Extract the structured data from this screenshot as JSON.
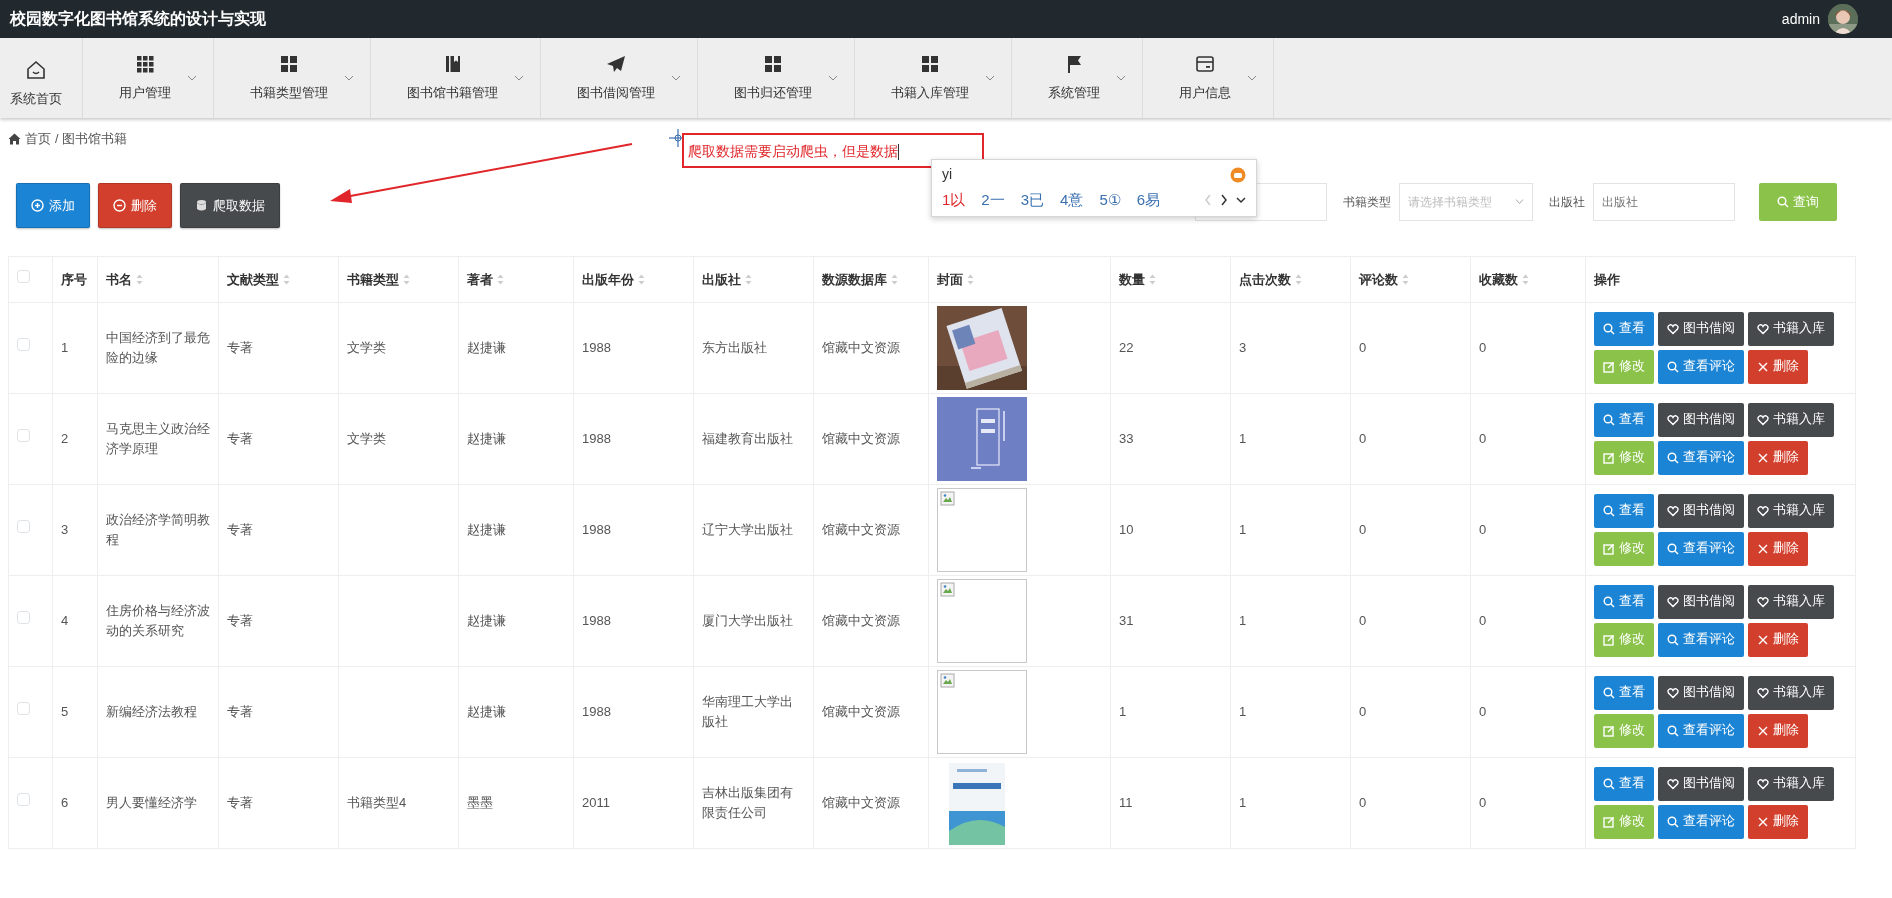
{
  "header": {
    "title": "校园数字化图书馆系统的设计与实现",
    "user": "admin"
  },
  "nav": [
    {
      "label": "系统首页",
      "dropdown": false
    },
    {
      "label": "用户管理",
      "dropdown": true
    },
    {
      "label": "书籍类型管理",
      "dropdown": true
    },
    {
      "label": "图书馆书籍管理",
      "dropdown": true
    },
    {
      "label": "图书借阅管理",
      "dropdown": true
    },
    {
      "label": "图书归还管理",
      "dropdown": true
    },
    {
      "label": "书籍入库管理",
      "dropdown": true
    },
    {
      "label": "系统管理",
      "dropdown": true
    },
    {
      "label": "用户信息",
      "dropdown": true
    }
  ],
  "breadcrumb": {
    "items": [
      "首页",
      "图书馆书籍"
    ],
    "separator": "/"
  },
  "toolbar": [
    {
      "label": "添加",
      "kind": "add"
    },
    {
      "label": "删除",
      "kind": "delete"
    },
    {
      "label": "爬取数据",
      "kind": "crawl"
    }
  ],
  "annotation": {
    "text": "爬取数据需要启动爬虫，但是数据"
  },
  "ime": {
    "input": "yi",
    "candidates": [
      {
        "label": "1以",
        "selected": true
      },
      {
        "label": "2一",
        "selected": false
      },
      {
        "label": "3已",
        "selected": false
      },
      {
        "label": "4意",
        "selected": false
      },
      {
        "label": "5①",
        "selected": false
      },
      {
        "label": "6易",
        "selected": false
      }
    ]
  },
  "search": {
    "fields": [
      {
        "kind": "input"
      },
      {
        "label": "书籍类型",
        "kind": "select",
        "placeholder": "请选择书籍类型"
      },
      {
        "label": "出版社",
        "kind": "input",
        "placeholder": "出版社"
      }
    ],
    "button": "查询"
  },
  "table": {
    "select_all": {
      "checked": false
    },
    "columns": [
      {
        "label": "序号",
        "sortable": false
      },
      {
        "label": "书名",
        "sortable": true
      },
      {
        "label": "文献类型",
        "sortable": true
      },
      {
        "label": "书籍类型",
        "sortable": true
      },
      {
        "label": "著者",
        "sortable": true
      },
      {
        "label": "出版年份",
        "sortable": true
      },
      {
        "label": "出版社",
        "sortable": true
      },
      {
        "label": "数源数据库",
        "sortable": true
      },
      {
        "label": "封面",
        "sortable": true
      },
      {
        "label": "数量",
        "sortable": true
      },
      {
        "label": "点击次数",
        "sortable": true
      },
      {
        "label": "评论数",
        "sortable": true
      },
      {
        "label": "收藏数",
        "sortable": true
      },
      {
        "label": "操作",
        "sortable": false
      }
    ],
    "rows": [
      {
        "checked": false,
        "no": "1",
        "title": "中国经济到了最危险的边缘",
        "doc_type": "专著",
        "book_type": "文学类",
        "author": "赵捷谦",
        "year": "1988",
        "publisher": "东方出版社",
        "source": "馆藏中文资源",
        "count": "22",
        "clicks": "3",
        "comments": "0",
        "favorites": "0",
        "actions": [
          {
            "label": "查看",
            "kind": "view"
          },
          {
            "label": "图书借阅",
            "kind": "borrow"
          },
          {
            "label": "书籍入库",
            "kind": "stock"
          },
          {
            "label": "修改",
            "kind": "edit"
          },
          {
            "label": "查看评论",
            "kind": "review"
          },
          {
            "label": "删除",
            "kind": "delete"
          }
        ]
      },
      {
        "checked": false,
        "no": "2",
        "title": "马克思主义政治经济学原理",
        "doc_type": "专著",
        "book_type": "文学类",
        "author": "赵捷谦",
        "year": "1988",
        "publisher": "福建教育出版社",
        "source": "馆藏中文资源",
        "count": "33",
        "clicks": "1",
        "comments": "0",
        "favorites": "0",
        "actions": [
          {
            "label": "查看",
            "kind": "view"
          },
          {
            "label": "图书借阅",
            "kind": "borrow"
          },
          {
            "label": "书籍入库",
            "kind": "stock"
          },
          {
            "label": "修改",
            "kind": "edit"
          },
          {
            "label": "查看评论",
            "kind": "review"
          },
          {
            "label": "删除",
            "kind": "delete"
          }
        ]
      },
      {
        "checked": false,
        "no": "3",
        "title": "政治经济学简明教程",
        "doc_type": "专著",
        "author": "赵捷谦",
        "year": "1988",
        "publisher": "辽宁大学出版社",
        "source": "馆藏中文资源",
        "cover": {
          "kind": "broken"
        },
        "count": "10",
        "clicks": "1",
        "comments": "0",
        "favorites": "0",
        "actions": [
          {
            "label": "查看",
            "kind": "view"
          },
          {
            "label": "图书借阅",
            "kind": "borrow"
          },
          {
            "label": "书籍入库",
            "kind": "stock"
          },
          {
            "label": "修改",
            "kind": "edit"
          },
          {
            "label": "查看评论",
            "kind": "review"
          },
          {
            "label": "删除",
            "kind": "delete"
          }
        ]
      },
      {
        "checked": false,
        "no": "4",
        "title": "住房价格与经济波动的关系研究",
        "doc_type": "专著",
        "author": "赵捷谦",
        "year": "1988",
        "publisher": "厦门大学出版社",
        "source": "馆藏中文资源",
        "cover": {
          "kind": "broken"
        },
        "count": "31",
        "clicks": "1",
        "comments": "0",
        "favorites": "0",
        "actions": [
          {
            "label": "查看",
            "kind": "view"
          },
          {
            "label": "图书借阅",
            "kind": "borrow"
          },
          {
            "label": "书籍入库",
            "kind": "stock"
          },
          {
            "label": "修改",
            "kind": "edit"
          },
          {
            "label": "查看评论",
            "kind": "review"
          },
          {
            "label": "删除",
            "kind": "delete"
          }
        ]
      },
      {
        "checked": false,
        "no": "5",
        "title": "新编经济法教程",
        "doc_type": "专著",
        "author": "赵捷谦",
        "year": "1988",
        "publisher": "华南理工大学出版社",
        "source": "馆藏中文资源",
        "cover": {
          "kind": "broken"
        },
        "count": "1",
        "clicks": "1",
        "comments": "0",
        "favorites": "0",
        "actions": [
          {
            "label": "查看",
            "kind": "view"
          },
          {
            "label": "图书借阅",
            "kind": "borrow"
          },
          {
            "label": "书籍入库",
            "kind": "stock"
          },
          {
            "label": "修改",
            "kind": "edit"
          },
          {
            "label": "查看评论",
            "kind": "review"
          },
          {
            "label": "删除",
            "kind": "delete"
          }
        ]
      },
      {
        "checked": false,
        "no": "6",
        "title": "男人要懂经济学",
        "doc_type": "专著",
        "book_type": "书籍类型4",
        "author": "墨墨",
        "year": "2011",
        "publisher": "吉林出版集团有限责任公司",
        "source": "馆藏中文资源",
        "count": "11",
        "clicks": "1",
        "comments": "0",
        "favorites": "0",
        "actions": [
          {
            "label": "查看",
            "kind": "view"
          },
          {
            "label": "图书借阅",
            "kind": "borrow"
          },
          {
            "label": "书籍入库",
            "kind": "stock"
          },
          {
            "label": "修改",
            "kind": "edit"
          },
          {
            "label": "查看评论",
            "kind": "review"
          },
          {
            "label": "删除",
            "kind": "delete"
          }
        ]
      }
    ]
  }
}
